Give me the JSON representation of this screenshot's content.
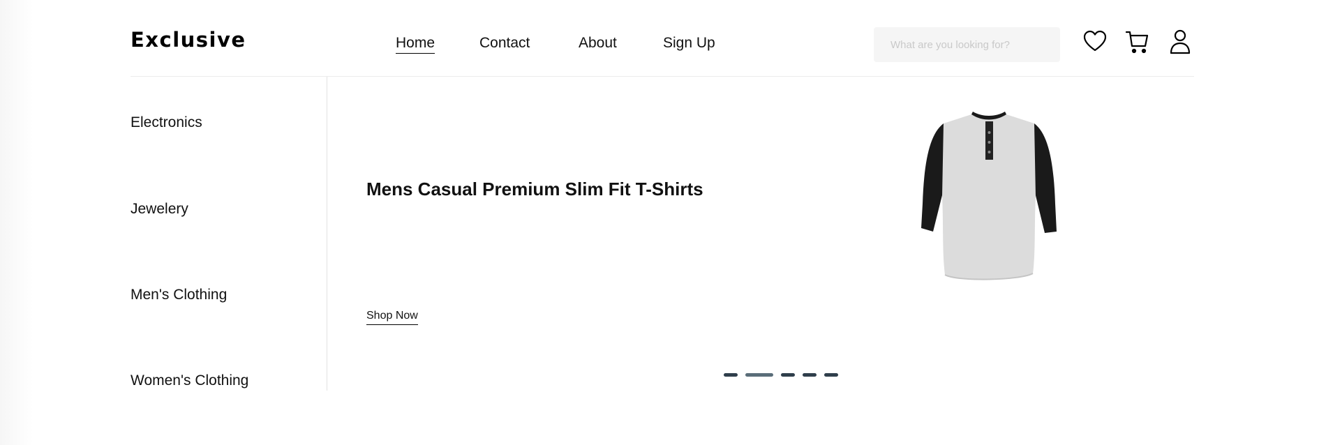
{
  "header": {
    "logo": "Exclusive",
    "nav": [
      {
        "label": "Home",
        "active": true
      },
      {
        "label": "Contact",
        "active": false
      },
      {
        "label": "About",
        "active": false
      },
      {
        "label": "Sign Up",
        "active": false
      }
    ],
    "search": {
      "placeholder": "What are you looking for?",
      "value": ""
    },
    "icons": [
      "heart-icon",
      "cart-icon",
      "user-icon"
    ]
  },
  "sidebar": {
    "items": [
      {
        "label": "Electronics"
      },
      {
        "label": "Jewelery"
      },
      {
        "label": "Men's Clothing"
      },
      {
        "label": "Women's Clothing"
      }
    ]
  },
  "hero": {
    "title": "Mens Casual Premium Slim Fit T-Shirts",
    "cta": "Shop Now",
    "image": "henley-raglan-shirt-image",
    "slides": {
      "count": 5,
      "active": 2
    }
  },
  "colors": {
    "text": "#000000",
    "search_bg": "#f5f5f5",
    "divider": "#e2e2e2",
    "dot": "#2f3e4b",
    "dot_active": "#5a6d79"
  }
}
